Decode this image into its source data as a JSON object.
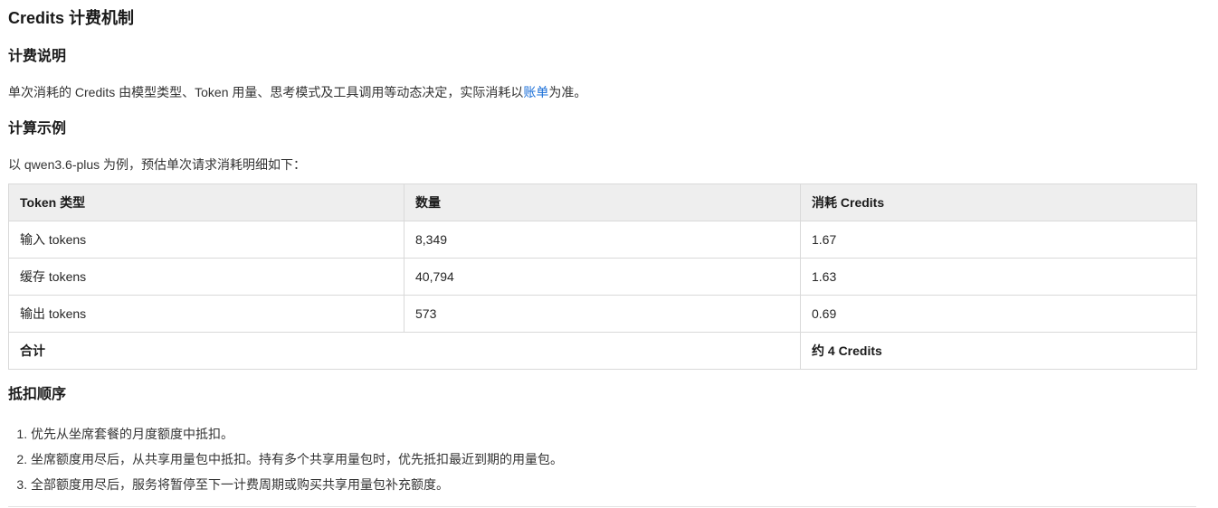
{
  "page": {
    "title": "Credits 计费机制"
  },
  "billing": {
    "heading": "计费说明",
    "text_before": "单次消耗的 Credits 由模型类型、Token 用量、思考模式及工具调用等动态决定，实际消耗以",
    "link_text": "账单",
    "text_after": "为准。"
  },
  "example": {
    "heading": "计算示例",
    "intro": "以 qwen3.6-plus 为例，预估单次请求消耗明细如下："
  },
  "table": {
    "headers": [
      "Token 类型",
      "数量",
      "消耗 Credits"
    ],
    "rows": [
      {
        "type": "输入 tokens",
        "quantity": "8,349",
        "credits": "1.67"
      },
      {
        "type": "缓存 tokens",
        "quantity": "40,794",
        "credits": "1.63"
      },
      {
        "type": "输出 tokens",
        "quantity": "573",
        "credits": "0.69"
      }
    ],
    "total": {
      "label": "合计",
      "credits": "约 4 Credits"
    }
  },
  "deduction": {
    "heading": "抵扣顺序",
    "items": [
      "优先从坐席套餐的月度额度中抵扣。",
      "坐席额度用尽后，从共享用量包中抵扣。持有多个共享用量包时，优先抵扣最近到期的用量包。",
      "全部额度用尽后，服务将暂停至下一计费周期或购买共享用量包补充额度。"
    ]
  }
}
